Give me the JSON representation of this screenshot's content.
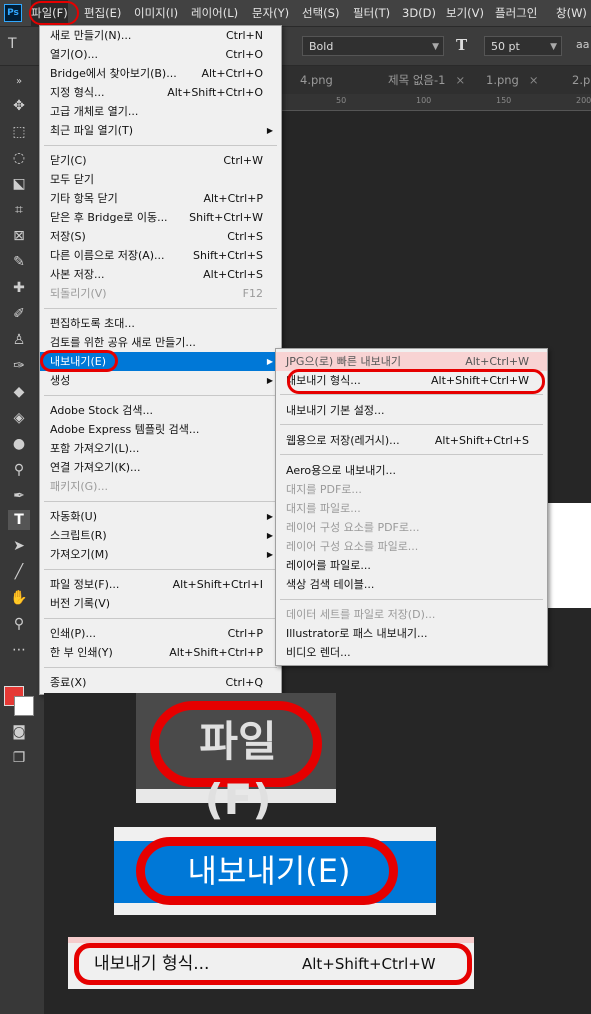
{
  "menubar": {
    "logo": "Ps",
    "items": [
      "파일(F)",
      "편집(E)",
      "이미지(I)",
      "레이어(L)",
      "문자(Y)",
      "선택(S)",
      "필터(T)",
      "3D(D)",
      "보기(V)",
      "플러그인",
      "창(W)"
    ]
  },
  "options": {
    "font_style": "Bold",
    "font_size": "50 pt",
    "aa_label": "aa"
  },
  "tabs": [
    "4.png",
    "제목 없음-1",
    "1.png",
    "2.p"
  ],
  "ruler_ticks": [
    "50",
    "100",
    "150",
    "200"
  ],
  "file_menu": {
    "items": [
      {
        "label": "새로 만들기(N)...",
        "shortcut": "Ctrl+N"
      },
      {
        "label": "열기(O)...",
        "shortcut": "Ctrl+O"
      },
      {
        "label": "Bridge에서 찾아보기(B)...",
        "shortcut": "Alt+Ctrl+O"
      },
      {
        "label": "지정 형식...",
        "shortcut": "Alt+Shift+Ctrl+O"
      },
      {
        "label": "고급 개체로 열기...",
        "shortcut": ""
      },
      {
        "label": "최근 파일 열기(T)",
        "shortcut": "",
        "submenu": true
      },
      {
        "label": "닫기(C)",
        "shortcut": "Ctrl+W"
      },
      {
        "label": "모두 닫기",
        "shortcut": ""
      },
      {
        "label": "기타 항목 닫기",
        "shortcut": "Alt+Ctrl+P"
      },
      {
        "label": "닫은 후 Bridge로 이동...",
        "shortcut": "Shift+Ctrl+W"
      },
      {
        "label": "저장(S)",
        "shortcut": "Ctrl+S"
      },
      {
        "label": "다른 이름으로 저장(A)...",
        "shortcut": "Shift+Ctrl+S"
      },
      {
        "label": "사본 저장...",
        "shortcut": "Alt+Ctrl+S"
      },
      {
        "label": "되돌리기(V)",
        "shortcut": "F12",
        "disabled": true
      },
      {
        "label": "편집하도록 초대...",
        "shortcut": ""
      },
      {
        "label": "검토를 위한 공유 새로 만들기...",
        "shortcut": ""
      },
      {
        "label": "내보내기(E)",
        "shortcut": "",
        "submenu": true,
        "highlighted": true
      },
      {
        "label": "생성",
        "shortcut": "",
        "submenu": true
      },
      {
        "label": "Adobe Stock 검색...",
        "shortcut": ""
      },
      {
        "label": "Adobe Express 템플릿 검색...",
        "shortcut": ""
      },
      {
        "label": "포함 가져오기(L)...",
        "shortcut": ""
      },
      {
        "label": "연결 가져오기(K)...",
        "shortcut": ""
      },
      {
        "label": "패키지(G)...",
        "shortcut": "",
        "disabled": true
      },
      {
        "label": "자동화(U)",
        "shortcut": "",
        "submenu": true
      },
      {
        "label": "스크립트(R)",
        "shortcut": "",
        "submenu": true
      },
      {
        "label": "가져오기(M)",
        "shortcut": "",
        "submenu": true
      },
      {
        "label": "파일 정보(F)...",
        "shortcut": "Alt+Shift+Ctrl+I"
      },
      {
        "label": "버전 기록(V)",
        "shortcut": ""
      },
      {
        "label": "인쇄(P)...",
        "shortcut": "Ctrl+P"
      },
      {
        "label": "한 부 인쇄(Y)",
        "shortcut": "Alt+Shift+Ctrl+P"
      },
      {
        "label": "종료(X)",
        "shortcut": "Ctrl+Q"
      }
    ]
  },
  "export_menu": {
    "items": [
      {
        "label": "JPG으(로) 빠른 내보내기",
        "shortcut": "Alt+Ctrl+W",
        "pink": true
      },
      {
        "label": "내보내기 형식...",
        "shortcut": "Alt+Shift+Ctrl+W"
      },
      {
        "label": "내보내기 기본 설정...",
        "shortcut": ""
      },
      {
        "label": "웹용으로 저장(레거시)...",
        "shortcut": "Alt+Shift+Ctrl+S"
      },
      {
        "label": "Aero용으로 내보내기...",
        "shortcut": ""
      },
      {
        "label": "대지를 PDF로...",
        "shortcut": "",
        "disabled": true
      },
      {
        "label": "대지를 파일로...",
        "shortcut": "",
        "disabled": true
      },
      {
        "label": "레이어 구성 요소를 PDF로...",
        "shortcut": "",
        "disabled": true
      },
      {
        "label": "레이어 구성 요소를 파일로...",
        "shortcut": "",
        "disabled": true
      },
      {
        "label": "레이어를 파일로...",
        "shortcut": ""
      },
      {
        "label": "색상 검색 테이블...",
        "shortcut": ""
      },
      {
        "label": "데이터 세트를 파일로 저장(D)...",
        "shortcut": "",
        "disabled": true
      },
      {
        "label": "Illustrator로 패스 내보내기...",
        "shortcut": ""
      },
      {
        "label": "비디오 렌더...",
        "shortcut": ""
      }
    ]
  },
  "zoom_callouts": {
    "file_label": "파일(F)",
    "export_label": "내보내기(E)",
    "export_as_label": "내보내기 형식...",
    "export_as_shortcut": "Alt+Shift+Ctrl+W"
  },
  "colors": {
    "highlight": "#0078d7",
    "annotation_red": "#e60000",
    "foreground_swatch": "#e53935",
    "background_swatch": "#ffffff"
  }
}
